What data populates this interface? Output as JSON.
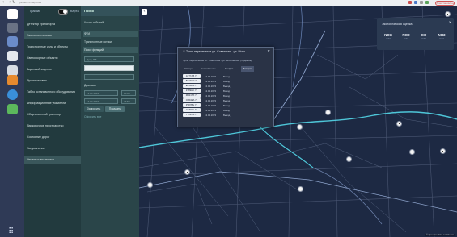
{
  "browser": {
    "back": "←",
    "forward": "→",
    "reload": "↻",
    "url": "yandex.ru/maps/tula",
    "account_label": "Приостановлено"
  },
  "panel_top": {
    "label": "Трафик",
    "mode": "Карта"
  },
  "sidebar": {
    "items": [
      {
        "label": "Детектор транспорта",
        "active": false
      },
      {
        "label": "Экология и климат",
        "active": true
      },
      {
        "label": "Транспортные узлы и объекты",
        "active": false
      },
      {
        "label": "Светофорные объекты",
        "active": false
      },
      {
        "label": "Видеонаблюдение",
        "active": false
      },
      {
        "label": "Происшествия",
        "active": false
      },
      {
        "label": "Табло остановочного оборудования",
        "active": false
      },
      {
        "label": "Информационные указатели",
        "active": false
      },
      {
        "label": "Общественный транспорт",
        "active": false
      },
      {
        "label": "Парковочное пространство",
        "active": false
      },
      {
        "label": "Состояние дорог",
        "active": false
      },
      {
        "label": "Уведомления",
        "active": false
      },
      {
        "label": "Отчеты и аналитика",
        "active": true
      }
    ]
  },
  "filter_panel": {
    "title": "Поиск",
    "row1": "Число событий",
    "section1": "ФТИ",
    "row2": "Транспортные потоки",
    "section2": "Поиск функций",
    "field1": "Тула, РФ",
    "field2": "",
    "field3": "",
    "section3": "Диапазон",
    "date_from": "13.04.2023",
    "time_from": "00:00",
    "date_to": "13.04.2023",
    "time_to": "23:59",
    "search_btn": "Запросить",
    "show_btn": "Показать",
    "reset_link": "Сбросить все"
  },
  "eco_panel": {
    "title": "Экологическая оценка",
    "close": "✕",
    "cells": [
      {
        "value": "NOX",
        "unit": "мг/м³"
      },
      {
        "value": "NO2",
        "unit": "мг/м³"
      },
      {
        "value": "CO",
        "unit": "мг/м³"
      },
      {
        "value": "NH3",
        "unit": "мг/м³"
      }
    ]
  },
  "popup": {
    "title": "✕ Тула, пересечение ул. Советская - ул. Мосх...",
    "close": "✕",
    "subtitle": "Тула, пересечение ул. Советская - ул. Московская (Ходынка)",
    "tabs": [
      "Камеры",
      "Направление",
      "График",
      "История"
    ],
    "rows": [
      {
        "plate": "А777АВ 71",
        "date": "13.04.2023",
        "dir": "Въезд"
      },
      {
        "plate": "В123ОР 71",
        "date": "13.04.2023",
        "dir": "Въезд"
      },
      {
        "plate": "Е456КМ 71",
        "date": "13.04.2023",
        "dir": "Выезд"
      },
      {
        "plate": "К789НС 71",
        "date": "13.04.2023",
        "dir": "Въезд"
      },
      {
        "plate": "М321ТХ 71",
        "date": "13.04.2023",
        "dir": "Въезд"
      },
      {
        "plate": "О654ЕА 71",
        "date": "13.04.2023",
        "dir": "Выезд"
      },
      {
        "plate": "Р987ВН 71",
        "date": "13.04.2023",
        "dir": "Въезд"
      },
      {
        "plate": "С159УК 71",
        "date": "13.04.2023",
        "dir": "Въезд"
      },
      {
        "plate": "Т753ХМ 71",
        "date": "13.04.2023",
        "dir": "Выезд"
      }
    ]
  },
  "map": {
    "collapse_btn": "‹",
    "attribution": "© OpenStreetMap contributors"
  },
  "colors": {
    "map_bg": "#1d2943",
    "road_main": "#4ec6d8",
    "road_minor": "#5a6781",
    "sidebar_bg": "#223a3e",
    "dock_bg": "#2f3a56"
  }
}
